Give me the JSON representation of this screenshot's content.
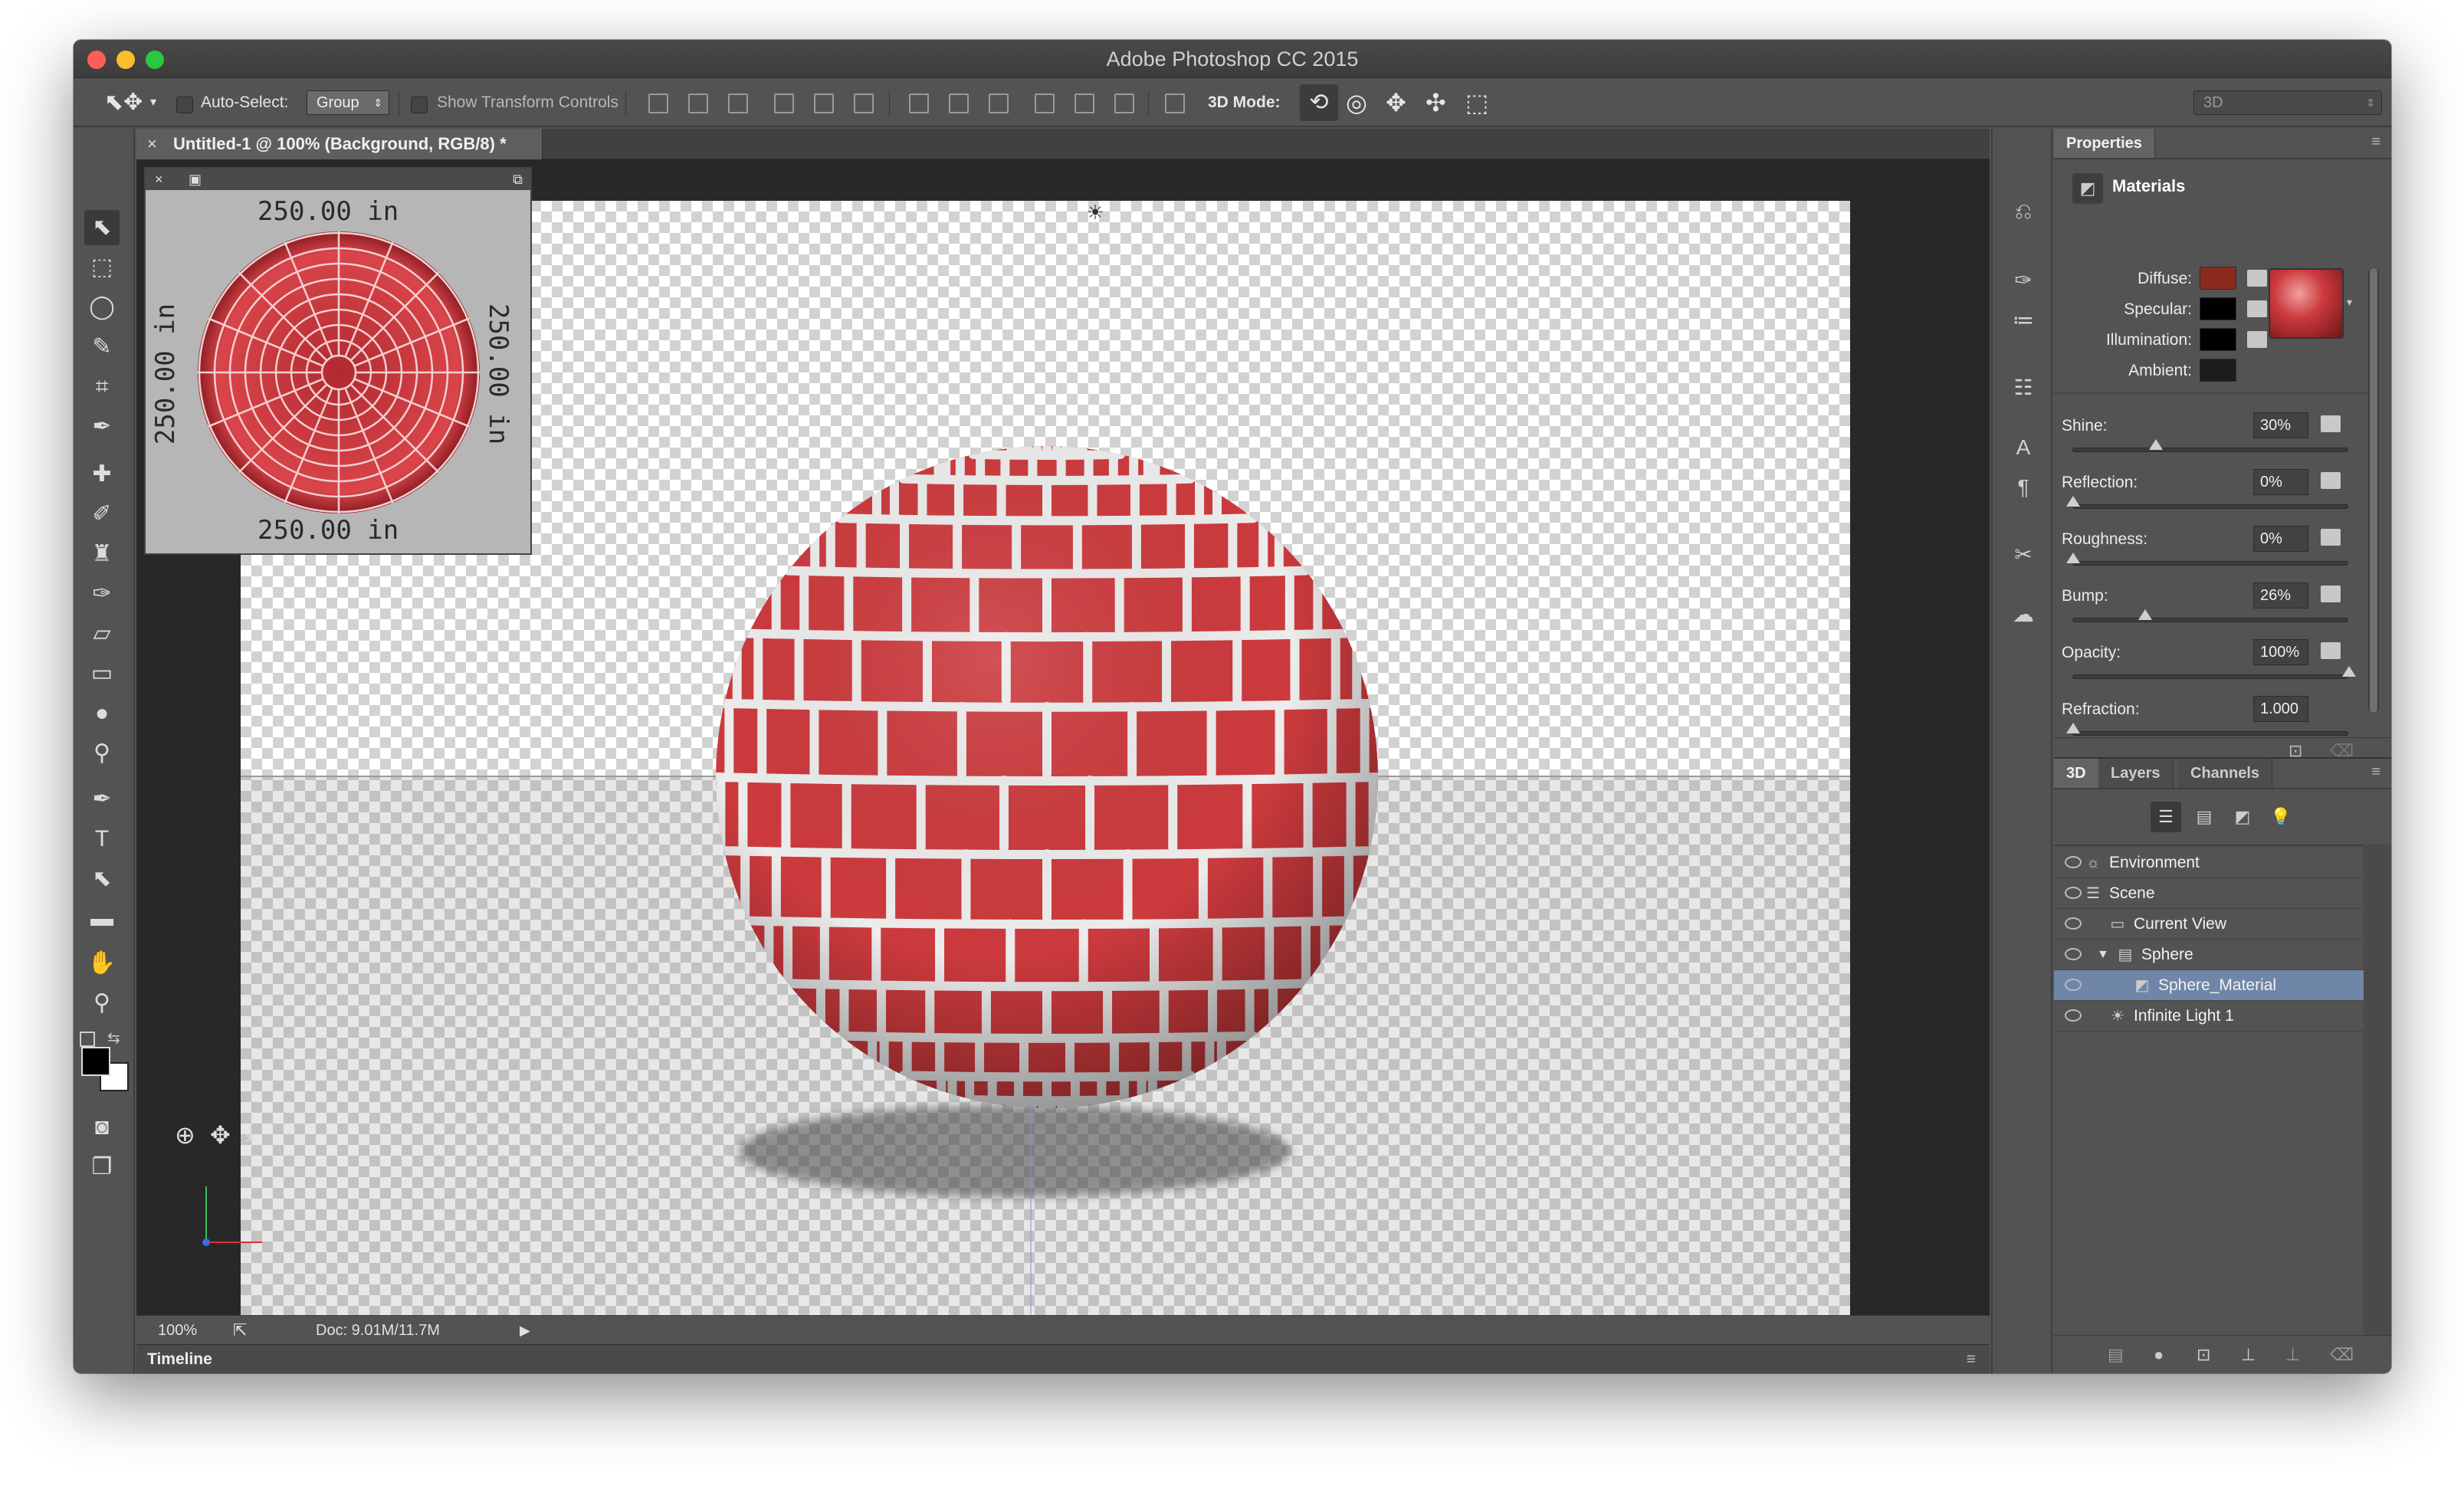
{
  "window": {
    "title": "Adobe Photoshop CC 2015"
  },
  "colors": {
    "diffuse": "#8b2a1c",
    "specular": "#000000",
    "illumination": "#000000",
    "ambient": "#1c1c1c",
    "brick": "#cc3a3d",
    "selection": "#6f86a8"
  },
  "options_bar": {
    "auto_select_label": "Auto-Select:",
    "auto_select_value": "Group",
    "show_transform_label": "Show Transform Controls",
    "mode_label": "3D Mode:",
    "workspace_value": "3D"
  },
  "document": {
    "tab_title": "Untitled-1 @ 100% (Background, RGB/8) *"
  },
  "uv_overlay": {
    "top": "250.00 in",
    "bottom": "250.00 in",
    "left": "250.00 in",
    "right": "250.00 in"
  },
  "status": {
    "zoom": "100%",
    "doc": "Doc: 9.01M/11.7M"
  },
  "timeline": {
    "label": "Timeline"
  },
  "properties": {
    "tab": "Properties",
    "section": "Materials",
    "diffuse_label": "Diffuse:",
    "specular_label": "Specular:",
    "illumination_label": "Illumination:",
    "ambient_label": "Ambient:",
    "sliders": [
      {
        "label": "Shine:",
        "value": "30%",
        "level": 0.3
      },
      {
        "label": "Reflection:",
        "value": "0%",
        "level": 0.0
      },
      {
        "label": "Roughness:",
        "value": "0%",
        "level": 0.0
      },
      {
        "label": "Bump:",
        "value": "26%",
        "level": 0.26
      },
      {
        "label": "Opacity:",
        "value": "100%",
        "level": 1.0
      },
      {
        "label": "Refraction:",
        "value": "1.000",
        "level": 0.0
      }
    ]
  },
  "panel3d": {
    "tabs": [
      "3D",
      "Layers",
      "Channels"
    ],
    "layers": [
      {
        "name": "Environment"
      },
      {
        "name": "Scene"
      },
      {
        "name": "Current View"
      },
      {
        "name": "Sphere"
      },
      {
        "name": "Sphere_Material"
      },
      {
        "name": "Infinite Light 1"
      }
    ]
  }
}
